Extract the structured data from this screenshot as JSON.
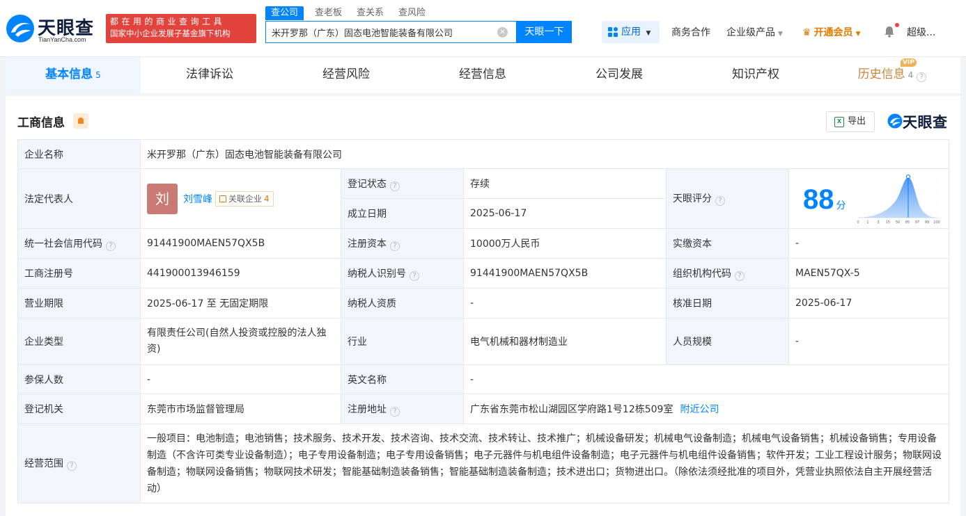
{
  "header": {
    "logo_text": "天眼查",
    "logo_sub": "TianYanCha.com",
    "slogan_line1": "都在用的商业查询工具",
    "slogan_line2": "国家中小企业发展子基金旗下机构",
    "search_tabs": [
      "查公司",
      "查老板",
      "查关系",
      "查风险"
    ],
    "search_value": "米开罗那（广东）固态电池智能装备有限公司",
    "search_button": "天眼一下",
    "apps": "应用",
    "nav": {
      "business": "商务合作",
      "enterprise": "企业级产品",
      "vip": "开通会员",
      "user": "超级..."
    }
  },
  "tabs": [
    {
      "label": "基本信息",
      "count": "5"
    },
    {
      "label": "法律诉讼"
    },
    {
      "label": "经营风险"
    },
    {
      "label": "经营信息"
    },
    {
      "label": "公司发展"
    },
    {
      "label": "知识产权"
    },
    {
      "label": "历史信息",
      "count": "4",
      "tag": "VIP"
    }
  ],
  "section": {
    "title": "工商信息",
    "export": "导出",
    "brand": "天眼查"
  },
  "info": {
    "company_name_label": "企业名称",
    "company_name": "米开罗那（广东）固态电池智能装备有限公司",
    "legal_rep_label": "法定代表人",
    "legal_rep_avatar": "刘",
    "legal_rep_name": "刘雪峰",
    "assoc_label": "关联企业",
    "assoc_count": "4",
    "reg_status_label": "登记状态",
    "reg_status": "存续",
    "found_date_label": "成立日期",
    "found_date": "2025-06-17",
    "score_label": "天眼评分",
    "score": "88",
    "score_unit": "分",
    "score_axis": [
      "0",
      "1",
      "3",
      "15",
      "50",
      "85",
      "97",
      "99",
      "100"
    ],
    "credit_code_label": "统一社会信用代码",
    "credit_code": "91441900MAEN57QX5B",
    "reg_capital_label": "注册资本",
    "reg_capital": "10000万人民币",
    "paid_capital_label": "实缴资本",
    "paid_capital": "-",
    "reg_no_label": "工商注册号",
    "reg_no": "441900013946159",
    "taxpayer_id_label": "纳税人识别号",
    "taxpayer_id": "91441900MAEN57QX5B",
    "org_code_label": "组织机构代码",
    "org_code": "MAEN57QX-5",
    "term_label": "营业期限",
    "term": "2025-06-17 至 无固定期限",
    "tax_qual_label": "纳税人资质",
    "tax_qual": "-",
    "approve_date_label": "核准日期",
    "approve_date": "2025-06-17",
    "type_label": "企业类型",
    "type": "有限责任公司(自然人投资或控股的法人独资)",
    "industry_label": "行业",
    "industry": "电气机械和器材制造业",
    "staff_label": "人员规模",
    "staff": "-",
    "insured_label": "参保人数",
    "insured": "-",
    "english_label": "英文名称",
    "english": "-",
    "authority_label": "登记机关",
    "authority": "东莞市市场监督管理局",
    "address_label": "注册地址",
    "address": "广东省东莞市松山湖园区学府路1号12栋509室",
    "nearby": "附近公司",
    "scope_label": "经营范围",
    "scope": "一般项目：电池制造；电池销售；技术服务、技术开发、技术咨询、技术交流、技术转让、技术推广；机械设备研发；机械电气设备制造；机械电气设备销售；机械设备销售；专用设备制造（不含许可类专业设备制造）；电子专用设备制造；电子专用设备销售；电子元器件与机电组件设备制造；电子元器件与机电组件设备销售；软件开发；工业工程设计服务；物联网设备制造；物联网设备销售；物联网技术研发；智能基础制造装备销售；智能基础制造装备制造；技术进出口；货物进出口。（除依法须经批准的项目外，凭营业执照依法自主开展经营活动）"
  },
  "colors": {
    "primary": "#0084ff",
    "slogan_bg": "#e2433c",
    "status_green": "#18a058",
    "vip_orange": "#e07b00"
  }
}
